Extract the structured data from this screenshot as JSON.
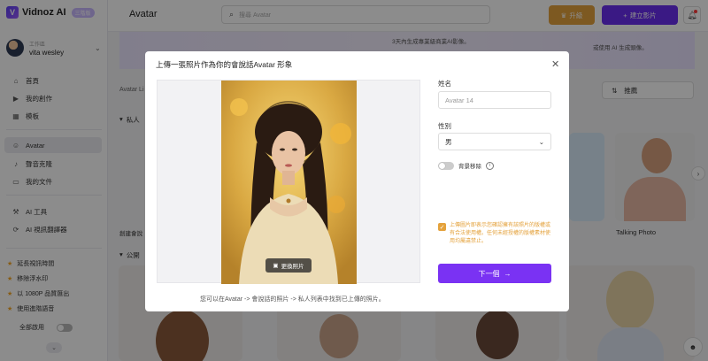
{
  "app": {
    "logo_text": "Vidnoz AI",
    "logo_badge": "三階版",
    "page_title": "Avatar"
  },
  "workspace": {
    "label": "工作區",
    "name": "vita wesley"
  },
  "sidebar": {
    "items": [
      {
        "label": "首頁",
        "icon": "home-icon"
      },
      {
        "label": "我的創作",
        "icon": "play-square-icon"
      },
      {
        "label": "模板",
        "icon": "template-icon"
      },
      {
        "label": "Avatar",
        "icon": "avatar-icon"
      },
      {
        "label": "聲音克隆",
        "icon": "voice-icon"
      },
      {
        "label": "我的文件",
        "icon": "folder-icon"
      },
      {
        "label": "AI 工具",
        "icon": "tools-icon"
      },
      {
        "label": "AI 視訊翻譯器",
        "icon": "translate-icon"
      }
    ],
    "perks": [
      "延長視訊時間",
      "移除浮水印",
      "以 1080P 品質匯出",
      "使用進階語音"
    ],
    "enable_all_label": "全部啟用"
  },
  "topbar": {
    "search_placeholder": "搜尋 Avatar",
    "upgrade_label": "升級",
    "new_video_label": "建立影片"
  },
  "background": {
    "sort_label": "推薦",
    "card_label": "Talking Photo",
    "banner_text_1": "3天內生成專業級商業AI影像。",
    "banner_text_2": "或使用 AI 生成頭像。",
    "section_private_prefix": "私人",
    "section_public_prefix": "公開",
    "avatar_label_prefix": "Avatar Li",
    "create_label_prefix": "創建會說"
  },
  "modal": {
    "title": "上傳一張照片作為你的會說話Avatar 形象",
    "replace_photo_label": "更換照片",
    "preview_hint": "您可以在Avatar -> 會說話的照片 -> 私人列表中找到已上傳的照片。",
    "name_label": "姓名",
    "name_placeholder": "Avatar 14",
    "gender_label": "性別",
    "gender_value": "男",
    "bg_remove_label": "背景移除",
    "consent_text": "上傳圖片即表示您確認擁有該照片的版權或有合法使用權。任何未經授權的版權素材使用均屬違禁止。",
    "next_label": "下一個"
  },
  "colors": {
    "accent": "#6b2ef0",
    "upgrade": "#e4a23c",
    "next_button": "#7a32f3"
  }
}
